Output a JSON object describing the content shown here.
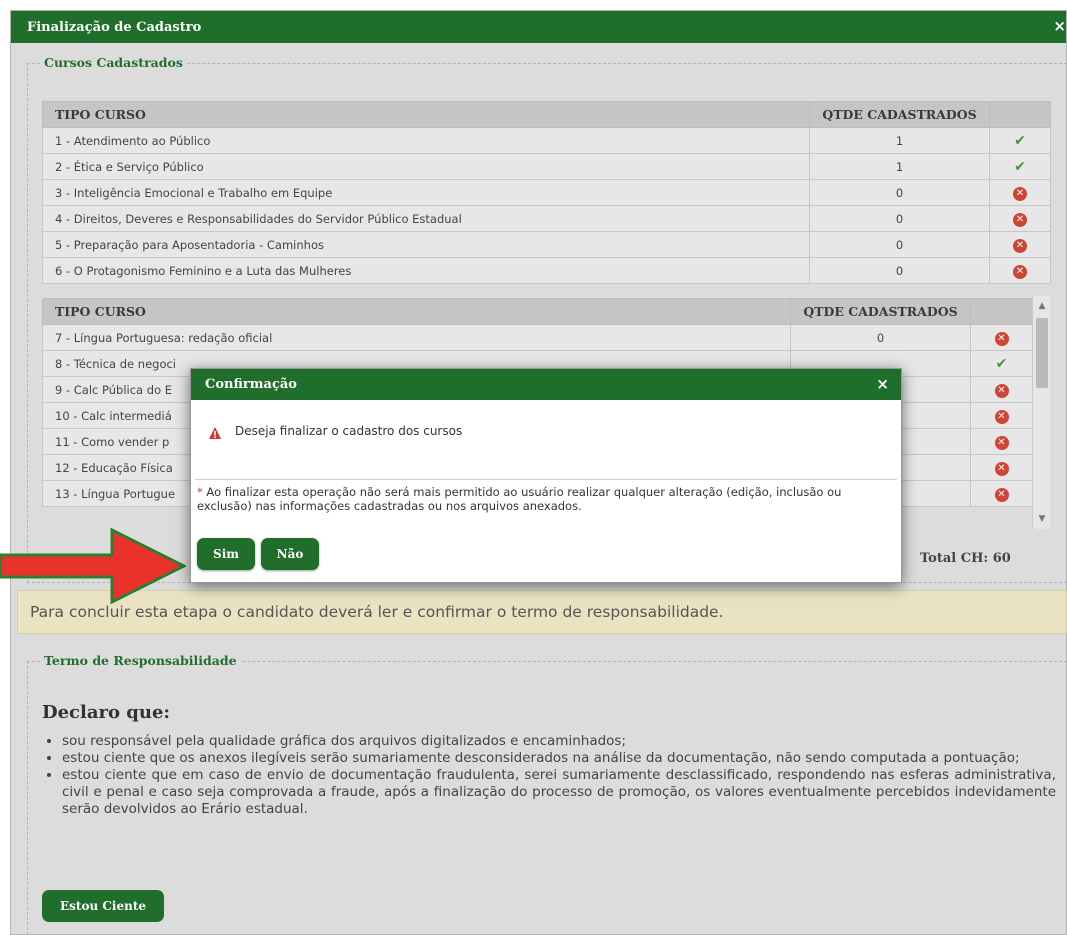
{
  "window": {
    "title": "Finalização de Cadastro",
    "close_glyph": "×"
  },
  "courses": {
    "legend": "Cursos Cadastrados",
    "table1": {
      "headers": [
        "TIPO CURSO",
        "QTDE CADASTRADOS"
      ],
      "rows": [
        {
          "name": "1 - Atendimento ao Público",
          "qty": "1",
          "status": "check-icon"
        },
        {
          "name": "2 - Ética e Serviço Público",
          "qty": "1",
          "status": "check-icon"
        },
        {
          "name": "3 - Inteligência Emocional e Trabalho em Equipe",
          "qty": "0",
          "status": "error-icon"
        },
        {
          "name": "4 - Direitos, Deveres e Responsabilidades do Servidor Público Estadual",
          "qty": "0",
          "status": "error-icon"
        },
        {
          "name": "5 - Preparação para Aposentadoria - Caminhos",
          "qty": "0",
          "status": "error-icon"
        },
        {
          "name": "6 - O Protagonismo Feminino e a Luta das Mulheres",
          "qty": "0",
          "status": "error-icon"
        }
      ]
    },
    "table2": {
      "headers": [
        "TIPO CURSO",
        "QTDE CADASTRADOS"
      ],
      "rows": [
        {
          "name": "7 - Língua Portuguesa: redação oficial",
          "qty": "0",
          "status": "error-icon"
        },
        {
          "name": "8 - Técnica de negoci",
          "qty": "",
          "status": "check-icon"
        },
        {
          "name": "9 - Calc Pública do E",
          "qty": "",
          "status": "error-icon"
        },
        {
          "name": "10 - Calc intermediá",
          "qty": "",
          "status": "error-icon"
        },
        {
          "name": "11 - Como vender p",
          "qty": "",
          "status": "error-icon"
        },
        {
          "name": "12 - Educação Física",
          "qty": "",
          "status": "error-icon"
        },
        {
          "name": "13 - Língua Portugue",
          "qty": "",
          "status": "error-icon"
        }
      ]
    },
    "total": "Total CH: 60"
  },
  "info_bar": "Para concluir esta etapa o candidato deverá ler e confirmar o termo de responsabilidade.",
  "term": {
    "legend": "Termo de Responsabilidade",
    "heading": "Declaro que:",
    "items": [
      "sou responsável pela qualidade gráfica dos arquivos digitalizados e encaminhados;",
      "estou ciente que os anexos ilegíveis serão sumariamente desconsiderados na análise da documentação, não sendo computada a pontuação;",
      "estou ciente que em caso de envio de documentação fraudulenta, serei sumariamente desclassificado, respondendo nas esferas administrativa, civil e penal e caso seja comprovada a fraude, após a finalização do processo de promoção, os valores eventualmente percebidos indevidamente serão devolvidos ao Erário estadual."
    ],
    "button": "Estou Ciente"
  },
  "modal": {
    "title": "Confirmação",
    "close_glyph": "×",
    "message": "Deseja finalizar o cadastro dos cursos",
    "note_star": "*",
    "note": " Ao finalizar esta operação não será mais permitido ao usuário realizar qualquer alteração (edição, inclusão ou exclusão) nas informações cadastradas ou nos arquivos anexados.",
    "yes": "Sim",
    "no": "Não"
  },
  "colors": {
    "brand_green": "#1f6e2c",
    "arrow_red": "#e8322a",
    "arrow_outline": "#2e7d32"
  }
}
